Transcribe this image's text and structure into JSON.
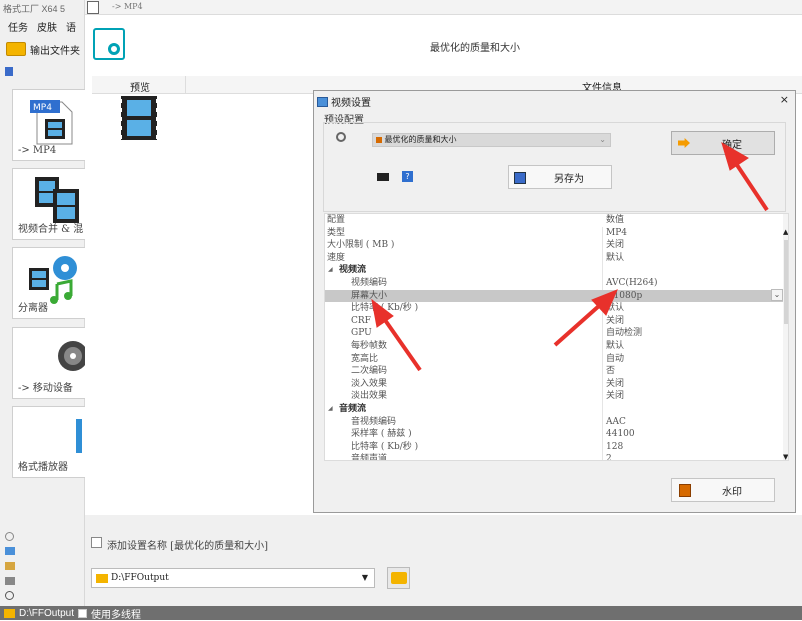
{
  "app": {
    "title": "格式工厂 X64 5",
    "menu": [
      "任务",
      "皮肤",
      "语"
    ],
    "output_folder_label": "输出文件夹"
  },
  "sidebar_tiles": [
    {
      "label": "-> MP4"
    },
    {
      "label": "视频合并 & 混"
    },
    {
      "label": "分离器"
    },
    {
      "label": "-> 移动设备"
    },
    {
      "label": "格式播放器"
    }
  ],
  "topbar": {
    "breadcrumb": "-> MP4"
  },
  "profile": {
    "title": "最优化的质量和大小"
  },
  "file_table": {
    "col_preview": "预览",
    "col_info": "文件信息"
  },
  "dialog": {
    "title": "视频设置",
    "close": "×",
    "preset_label": "预设配置",
    "preset_value": "最优化的质量和大小",
    "ok_label": "确定",
    "saveas_label": "另存为",
    "watermark_label": "水印",
    "header_key": "配置",
    "header_value": "数值",
    "rows": [
      {
        "key": "类型",
        "value": "MP4",
        "level": 0
      },
      {
        "key": "大小限制 ( MB )",
        "value": "关闭",
        "level": 0
      },
      {
        "key": "速度",
        "value": "默认",
        "level": 0
      },
      {
        "key": "视频流",
        "value": "",
        "level": 0,
        "group": true
      },
      {
        "key": "视频编码",
        "value": "AVC(H264)",
        "level": 1
      },
      {
        "key": "屏幕大小",
        "value": "<1080p",
        "level": 1,
        "selected": true
      },
      {
        "key": "比特率 ( Kb/秒 )",
        "value": "默认",
        "level": 1
      },
      {
        "key": "CRF",
        "value": "关闭",
        "level": 1
      },
      {
        "key": "GPU",
        "value": "自动检测",
        "level": 1
      },
      {
        "key": "每秒帧数",
        "value": "默认",
        "level": 1
      },
      {
        "key": "宽高比",
        "value": "自动",
        "level": 1
      },
      {
        "key": "二次编码",
        "value": "否",
        "level": 1
      },
      {
        "key": "淡入效果",
        "value": "关闭",
        "level": 1
      },
      {
        "key": "淡出效果",
        "value": "关闭",
        "level": 1
      },
      {
        "key": "音频流",
        "value": "",
        "level": 0,
        "group": true
      },
      {
        "key": "音视频编码",
        "value": "AAC",
        "level": 1
      },
      {
        "key": "采样率 ( 赫兹 )",
        "value": "44100",
        "level": 1
      },
      {
        "key": "比特率 ( Kb/秒 )",
        "value": "128",
        "level": 1
      },
      {
        "key": "音频声道",
        "value": "2",
        "level": 1
      }
    ]
  },
  "bottom": {
    "add_setting_name": "添加设置名称 [最优化的质量和大小]",
    "output_path": "D:\\FFOutput"
  },
  "statusbar": {
    "path": "D:\\FFOutput",
    "multithread": "使用多线程"
  },
  "colors": {
    "accent": "#00a2b5",
    "arrow": "#e8312b",
    "status_bg": "#6f6f6f"
  }
}
